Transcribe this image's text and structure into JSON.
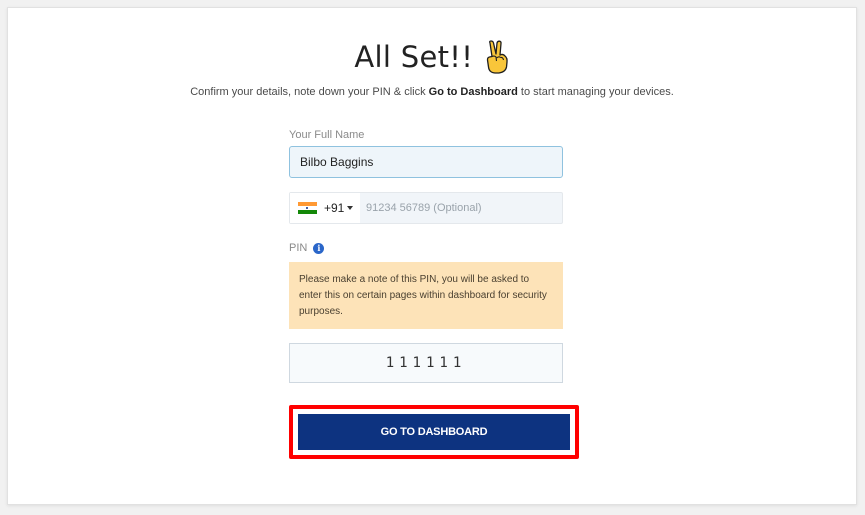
{
  "header": {
    "title": "All Set!!",
    "title_icon": "victory-hand-icon",
    "subtitle_before": "Confirm your details, note down your PIN & click ",
    "subtitle_bold": "Go to Dashboard",
    "subtitle_after": " to start managing your devices."
  },
  "form": {
    "name": {
      "label": "Your Full Name",
      "value": "Bilbo Baggins"
    },
    "phone": {
      "country_flag": "india-flag-icon",
      "dial_code": "+91",
      "value": "",
      "placeholder": "91234 56789 (Optional)"
    },
    "pin": {
      "label": "PIN",
      "info_icon": "info-icon",
      "note": "Please make a note of this PIN, you will be asked to enter this on certain pages within dashboard for security purposes.",
      "value": "111111"
    }
  },
  "actions": {
    "dashboard_label": "GO TO DASHBOARD"
  },
  "colors": {
    "primary_button": "#0d3380",
    "highlight_border": "#ff0000",
    "note_background": "#fde3b8",
    "info_icon": "#2a66c9",
    "flag_saffron": "#ff9933",
    "flag_green": "#138808",
    "hand_skin": "#f9c63a"
  }
}
